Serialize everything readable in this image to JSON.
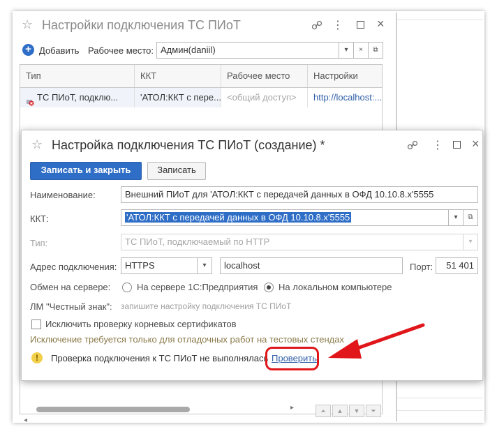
{
  "bg_window": {
    "title": "Настройки подключения ТС ПИоТ",
    "add_label": "Добавить",
    "workplace_label": "Рабочее место:",
    "workplace_value": "Админ(daniil)",
    "columns": [
      "Тип",
      "ККТ",
      "Рабочее место",
      "Настройки"
    ],
    "row": {
      "type": "ТС ПИоТ, подклю...",
      "kkt": "'АТОЛ:ККТ с пере...",
      "workplace": "<общий доступ>",
      "settings": "http://localhost:..."
    }
  },
  "dialog": {
    "title": "Настройка подключения ТС ПИоТ (создание) *",
    "save_close_label": "Записать и закрыть",
    "save_label": "Записать",
    "name_label": "Наименование:",
    "name_value": "Внешний ПИоТ для 'АТОЛ:ККТ с передачей данных в ОФД 10.10.8.x'5555",
    "kkt_label": "ККТ:",
    "kkt_value": "'АТОЛ:ККТ с передачей данных в ОФД 10.10.8.x'5555",
    "type_label": "Тип:",
    "type_value": "ТС ПИоТ, подключаемый по HTTP",
    "address_label": "Адрес подключения:",
    "protocol_value": "HTTPS",
    "host_value": "localhost",
    "port_label": "Порт:",
    "port_value": "51 401",
    "exchange_label": "Обмен на сервере:",
    "radio_server": "На сервере 1С:Предприятия",
    "radio_local": "На локальном компьютере",
    "lm_label": "ЛМ \"Честный знак\":",
    "lm_placeholder": "запишите настройку подключения ТС ПИоТ",
    "checkbox_label": "Исключить проверку корневых сертификатов",
    "note_text": "Исключение требуется только для отладочных работ на тестовых стендах",
    "status_text": "Проверка подключения к ТС ПИоТ не выполнялась",
    "check_link": "Проверить"
  },
  "colors": {
    "accent": "#2f6ec6",
    "annotation": "#e0161b"
  }
}
